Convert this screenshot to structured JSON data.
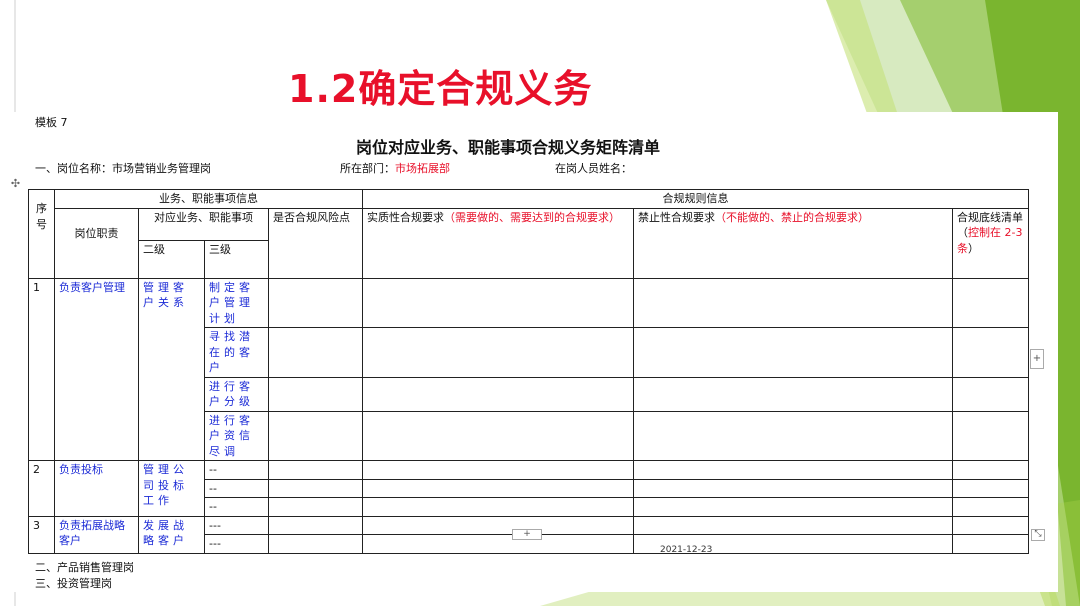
{
  "slide_title": "1.2确定合规义务",
  "template_label": "模板 7",
  "doc_title": "岗位对应业务、职能事项合规义务矩阵清单",
  "info": {
    "post_prefix": "一、岗位名称：市场营销业务管理岗",
    "dept_label": "所在部门：",
    "dept_value": "市场拓展部",
    "staff_label": "在岗人员姓名："
  },
  "table": {
    "seq_header": "序号",
    "group_business": "业务、职能事项信息",
    "group_compliance": "合规规则信息",
    "duty_header": "岗位职责",
    "biz_header": "对应业务、职能事项",
    "level2": "二级",
    "level3": "三级",
    "risk_header": "是否合规风险点",
    "substantive_label": "实质性合规要求",
    "substantive_note": "（需要做的、需要达到的合规要求）",
    "prohibitive_label": "禁止性合规要求",
    "prohibitive_note": "（不能做的、禁止的合规要求）",
    "baseline_label": "合规底线清单",
    "baseline_open": "（",
    "baseline_note": "控制在 2-3条",
    "baseline_close": "）",
    "rows": [
      {
        "seq": "1",
        "duty": "负责客户管理",
        "level2": "管理客户关系",
        "level3": [
          "制定客户管理计划",
          "寻找潜在的客户",
          "进行客户分级",
          "进行客户资信尽调"
        ]
      },
      {
        "seq": "2",
        "duty": "负责投标",
        "level2": "管理公司投标工作",
        "level3": [
          "--",
          "--",
          "--"
        ]
      },
      {
        "seq": "3",
        "duty": "负责拓展战略客户",
        "level2": "发展战略客户",
        "level3": [
          "---",
          "---"
        ]
      }
    ]
  },
  "date": "2021-12-23",
  "sections": [
    "二、产品销售管理岗",
    "三、投资管理岗"
  ],
  "controls": {
    "move": "✣",
    "add": "+",
    "resize": "⤡"
  },
  "colors": {
    "title_red": "#e8102a",
    "link_blue": "#1c2bd6",
    "green_light": "#b8d95a",
    "green_dark": "#7bb82a"
  }
}
